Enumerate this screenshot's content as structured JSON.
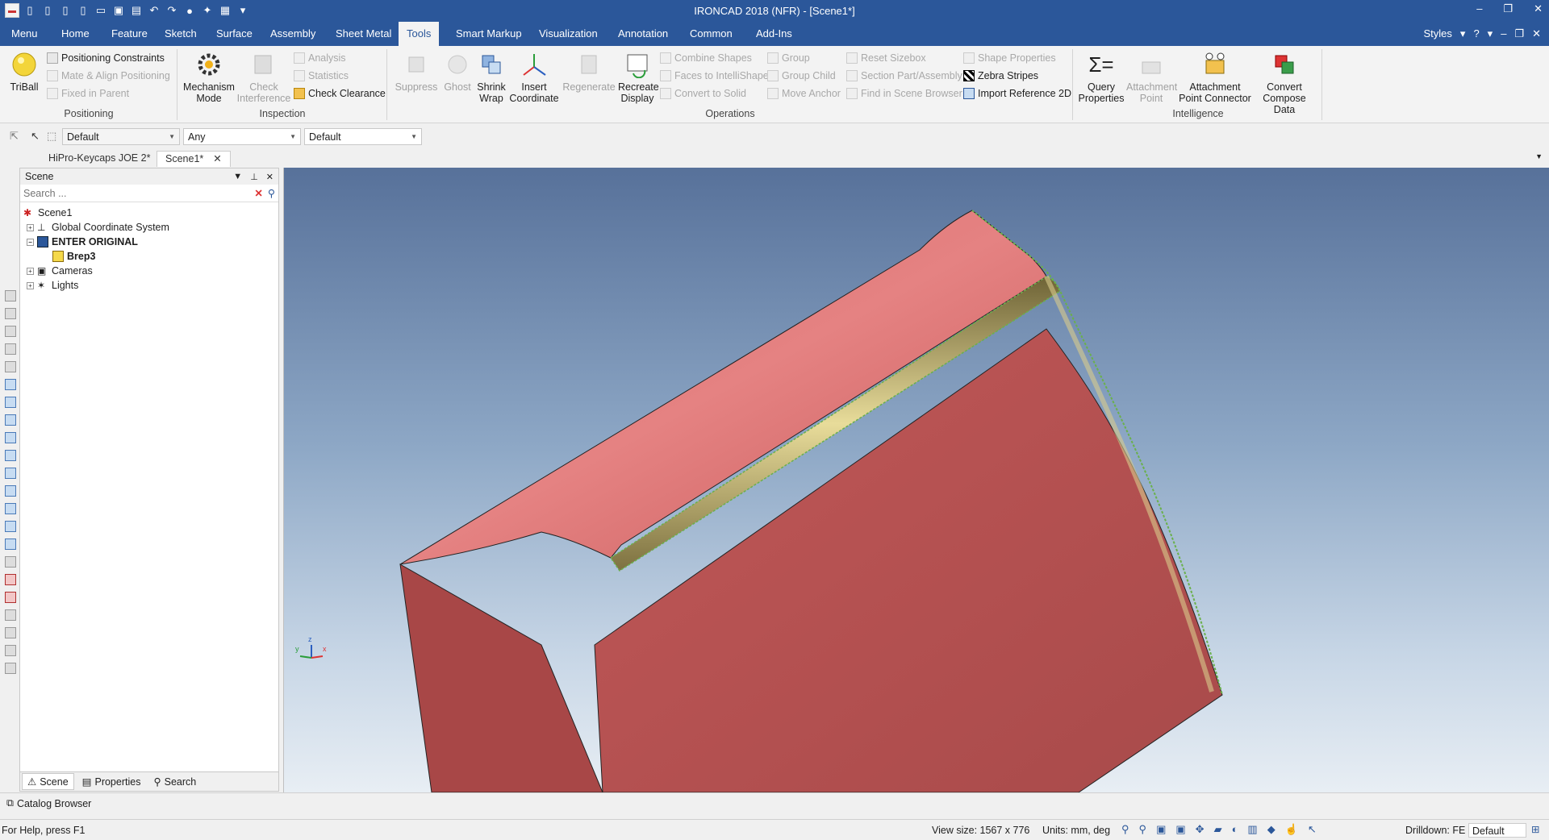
{
  "window": {
    "title": "IRONCAD 2018 (NFR) - [Scene1*]"
  },
  "menu": {
    "tabs": [
      "Menu",
      "Home",
      "Feature",
      "Sketch",
      "Surface",
      "Assembly",
      "Sheet Metal",
      "Tools",
      "Smart Markup",
      "Visualization",
      "Annotation",
      "Common",
      "Add-Ins"
    ],
    "active": "Tools",
    "styles_label": "Styles"
  },
  "ribbon": {
    "positioning": {
      "label": "Positioning",
      "triball": "TriBall",
      "positioning_constraints": "Positioning Constraints",
      "mate_align": "Mate & Align Positioning",
      "fixed_in_parent": "Fixed in Parent"
    },
    "inspection": {
      "label": "Inspection",
      "mechanism_mode_1": "Mechanism",
      "mechanism_mode_2": "Mode",
      "check_interference_1": "Check",
      "check_interference_2": "Interference",
      "analysis": "Analysis",
      "statistics": "Statistics",
      "check_clearance": "Check Clearance"
    },
    "operations": {
      "label": "Operations",
      "suppress": "Suppress",
      "ghost": "Ghost",
      "shrink_wrap_1": "Shrink",
      "shrink_wrap_2": "Wrap",
      "insert_coordinate_1": "Insert",
      "insert_coordinate_2": "Coordinate",
      "regenerate": "Regenerate",
      "recreate_display_1": "Recreate",
      "recreate_display_2": "Display",
      "combine_shapes": "Combine Shapes",
      "faces_to_intellishape": "Faces to IntelliShape",
      "convert_to_solid": "Convert to Solid",
      "group": "Group",
      "group_child": "Group Child",
      "move_anchor": "Move Anchor",
      "reset_sizebox": "Reset Sizebox",
      "section_part": "Section Part/Assembly",
      "find_in_scene": "Find in Scene Browser",
      "shape_properties": "Shape Properties",
      "zebra_stripes": "Zebra Stripes",
      "import_reference": "Import Reference 2D"
    },
    "intelligence": {
      "label": "Intelligence",
      "query_properties_1": "Query",
      "query_properties_2": "Properties",
      "attachment_point_1": "Attachment",
      "attachment_point_2": "Point",
      "attachment_connector_1": "Attachment",
      "attachment_connector_2": "Point Connector",
      "convert_compose_1": "Convert",
      "convert_compose_2": "Compose Data"
    }
  },
  "toolbar2": {
    "combo1": "Default",
    "combo2": "Any",
    "combo3": "Default"
  },
  "doc_tabs": [
    "HiPro-Keycaps JOE 2*",
    "Scene1*"
  ],
  "scene_panel": {
    "title": "Scene",
    "search_placeholder": "Search ...",
    "tree": [
      "Scene1",
      "Global Coordinate System",
      "ENTER ORIGINAL",
      "Brep3",
      "Cameras",
      "Lights"
    ],
    "bottom_tabs": [
      "Scene",
      "Properties",
      "Search"
    ]
  },
  "catalog": {
    "label": "Catalog Browser"
  },
  "status": {
    "help": "For Help, press F1",
    "view_size": "View size: 1567 x  776",
    "units": "Units: mm, deg",
    "drilldown": "Drilldown: FE",
    "default": "Default"
  },
  "axes": {
    "x": "x",
    "y": "y",
    "z": "z"
  }
}
